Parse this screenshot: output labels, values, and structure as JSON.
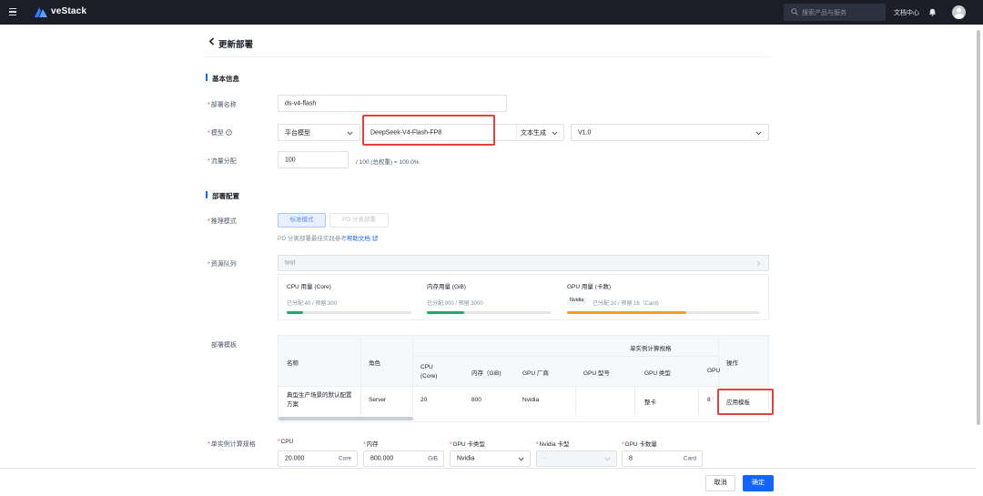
{
  "topbar": {
    "brand": "veStack",
    "search_placeholder": "搜索产品与服务",
    "doc_center": "文档中心"
  },
  "page": {
    "title": "更新部署"
  },
  "basic": {
    "section_title": "基本信息",
    "name_label": "部署名称",
    "name_value": "ds-v4-flash",
    "model_label": "模型",
    "model_source": "平台模型",
    "model_name": "DeepSeek-V4-Flash-FP8",
    "model_task": "文本生成",
    "model_version": "V1.0",
    "traffic_label": "流量分配",
    "traffic_value": "100",
    "traffic_hint": "/ 100 (总权重) = 100.0%"
  },
  "deploy": {
    "section_title": "部署配置",
    "mode_label": "推理模式",
    "mode_standard": "标准模式",
    "mode_pd": "PD 分离部署",
    "pd_hint": "PD 分离部署最佳实践参考",
    "help_link": "帮助文档",
    "queue_label": "资源队列",
    "queue_value": "test",
    "cpu_title": "CPU 用量 (Core)",
    "cpu_stat": "已分配:40 / 预留:300",
    "cpu_fraction": 0.13,
    "mem_title": "内存用量 (GiB)",
    "mem_stat": "已分配:900 / 预留:3000",
    "mem_fraction": 0.3,
    "gpu_title": "GPU 用量 (卡数)",
    "gpu_tag": "Nvidia",
    "gpu_stat": "已分配:10 / 预留 16（Card)",
    "gpu_fraction": 0.62,
    "colors": {
      "cpu": "#2ba471",
      "mem": "#2ba471",
      "gpu": "#f0a020"
    }
  },
  "template": {
    "label": "部署模板",
    "group_header": "单实例计算规格",
    "headers": {
      "name": "名称",
      "role": "角色",
      "cpu": "CPU\n(Core)",
      "mem": "内存（GiB)",
      "gpu_vendor": "GPU 厂商",
      "gpu_model": "GPU 型号",
      "gpu_type": "GPU 类型",
      "gpu_count": "GPU",
      "action": "操作"
    },
    "row": {
      "name": "典型生产场景的默认配置方案",
      "role": "Server",
      "cpu": "20",
      "mem": "800",
      "gpu_vendor": "Nvidia",
      "gpu_model": "",
      "gpu_type": "整卡",
      "gpu_count": "8",
      "action": "应用模板"
    }
  },
  "spec": {
    "label": "单实例计算规格",
    "cpu_label": "CPU",
    "cpu_value": "20.000",
    "cpu_unit": "Core",
    "mem_label": "内存",
    "mem_value": "800.000",
    "mem_unit": "GiB",
    "gpu_type_label": "GPU 卡类型",
    "gpu_type_value": "Nvidia",
    "nvidia_label": "Nvidia 卡型",
    "nvidia_value": "-",
    "gpu_count_label": "GPU 卡数量",
    "gpu_count_value": "8",
    "gpu_count_unit": "Card"
  },
  "footer": {
    "cancel": "取消",
    "confirm": "确定"
  },
  "accent": "#1664ff",
  "highlight": "#e2413e"
}
